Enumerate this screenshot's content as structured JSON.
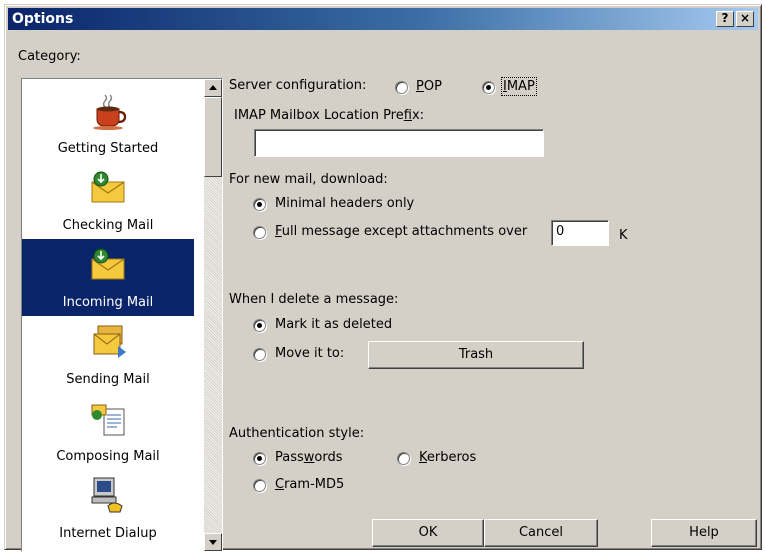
{
  "window": {
    "title": "Options",
    "help_button": "?",
    "close_button": "×"
  },
  "category": {
    "label": "Category:",
    "items": [
      {
        "label": "Getting Started",
        "icon": "coffee-cup-icon",
        "selected": false
      },
      {
        "label": "Checking Mail",
        "icon": "envelope-check-icon",
        "selected": false
      },
      {
        "label": "Incoming Mail",
        "icon": "envelope-incoming-icon",
        "selected": true
      },
      {
        "label": "Sending Mail",
        "icon": "envelopes-sending-icon",
        "selected": false
      },
      {
        "label": "Composing Mail",
        "icon": "compose-document-icon",
        "selected": false
      },
      {
        "label": "Internet Dialup",
        "icon": "computer-phone-icon",
        "selected": false
      }
    ]
  },
  "server_config": {
    "label": "Server configuration:",
    "options": [
      "POP",
      "IMAP"
    ],
    "selected": "IMAP"
  },
  "imap_prefix": {
    "label": "IMAP Mailbox Location Prefix:",
    "value": ""
  },
  "download": {
    "label": "For new mail, download:",
    "option_minimal": "Minimal headers only",
    "option_full": "Full message except attachments over",
    "size_value": "0",
    "size_unit": "K",
    "selected": "Minimal headers only"
  },
  "delete": {
    "label": "When I delete a message:",
    "option_mark": "Mark it as deleted",
    "option_move": "Move it to:",
    "folder": "Trash",
    "selected": "Mark it as deleted"
  },
  "auth": {
    "label": "Authentication style:",
    "option_passwords": "Passwords",
    "option_kerberos": "Kerberos",
    "option_cram": "Cram-MD5",
    "selected": "Passwords"
  },
  "buttons": {
    "ok": "OK",
    "cancel": "Cancel",
    "help": "Help"
  },
  "colors": {
    "dialog_face": "#d4d0c8",
    "selection": "#0a246a"
  }
}
